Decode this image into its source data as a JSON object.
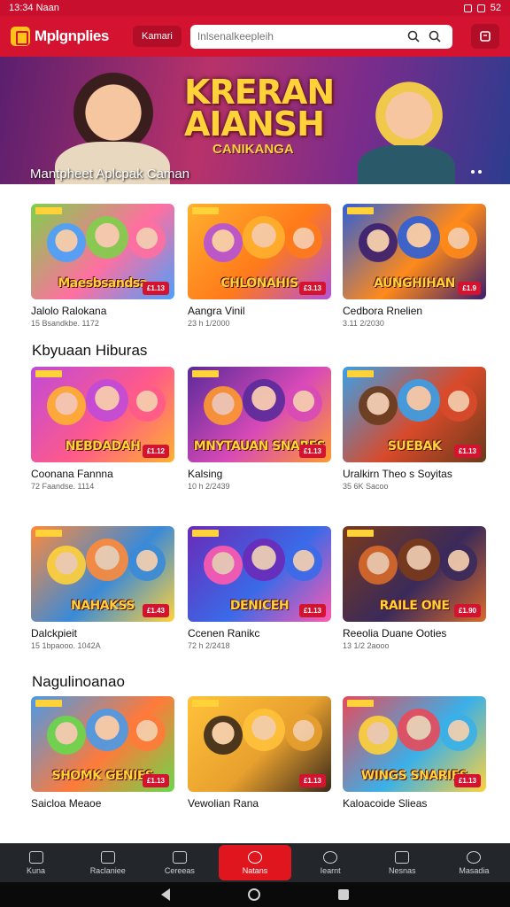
{
  "status": {
    "time": "13:34",
    "carrier": "Naan",
    "battery": "52"
  },
  "header": {
    "app_name": "Mplgnplies",
    "menu_label": "Kamari",
    "search_placeholder": "Inlsenalkeepleih"
  },
  "hero": {
    "title_line1": "KRERAN",
    "title_line2": "AIANSH",
    "subtitle": "CANIKANGA",
    "caption": "Mantpheet Aplcpak Caman"
  },
  "sections": [
    {
      "title": "",
      "cards": [
        {
          "game_name": "Maesbsandsa",
          "title": "Jalolo Ralokana",
          "meta": "15 Bsandkbe. 1172",
          "price": "£1.13",
          "colors": [
            "#7fd04a",
            "#ff6fa0",
            "#4aa0ff"
          ]
        },
        {
          "game_name": "CHLONAHIS",
          "title": "Aangra Vinil",
          "meta": "23 h 1/2000",
          "price": "£3.13",
          "colors": [
            "#ffb02e",
            "#ff7a1a",
            "#b452d8"
          ]
        },
        {
          "game_name": "AUNGHIHAN",
          "title": "Cedbora Rnelien",
          "meta": "3.11 2/2030",
          "price": "£1.9",
          "colors": [
            "#2e5fd8",
            "#ff8a1a",
            "#3a1e6e"
          ]
        }
      ]
    },
    {
      "title": "Kbyuaan Hiburas",
      "cards": [
        {
          "game_name": "NEBDADAH",
          "title": "Coonana Fannna",
          "meta": "72 Faandse. 1114",
          "price": "£1.12",
          "colors": [
            "#c04ad8",
            "#ff5a8a",
            "#ffb12e"
          ]
        },
        {
          "game_name": "MNYTAUAN SNARES",
          "title": "Kalsing",
          "meta": "10 h 2/2439",
          "price": "£1.13",
          "colors": [
            "#5a2a9a",
            "#d84ab8",
            "#ff9a2e"
          ]
        },
        {
          "game_name": "SUEBAK",
          "title": "Uralkirn Theo s Soyitas",
          "meta": "35 6K Sacoo",
          "price": "£1.13",
          "colors": [
            "#3aa0e8",
            "#d84a2a",
            "#6a3a1a"
          ]
        }
      ]
    },
    {
      "title": "",
      "cards": [
        {
          "game_name": "NAHAKSS",
          "title": "Dalckpieit",
          "meta": "15 1bpaooo. 1042A",
          "price": "£1.43",
          "colors": [
            "#ff8a3a",
            "#3a8ad8",
            "#ffd23a"
          ]
        },
        {
          "game_name": "DENICEH",
          "title": "Ccenen Ranikc",
          "meta": "72 h 2/2418",
          "price": "£1.13",
          "colors": [
            "#6a2ab8",
            "#3a6ae8",
            "#ff5ab0"
          ]
        },
        {
          "game_name": "RAILE ONE",
          "title": "Reeolia Duane Ooties",
          "meta": "13 1/2 2aooo",
          "price": "£1.90",
          "colors": [
            "#7a3a1a",
            "#3a2a5a",
            "#d86a2a"
          ]
        }
      ]
    },
    {
      "title": "Nagulinoanao",
      "cards": [
        {
          "game_name": "SHOMK GENIES",
          "title": "Saicloa Meaoe",
          "meta": "",
          "price": "£1.13",
          "colors": [
            "#4a9ae8",
            "#ff7a3a",
            "#6ad84a"
          ]
        },
        {
          "game_name": "",
          "title": "Vewolian Rana",
          "meta": "",
          "price": "£1.13",
          "colors": [
            "#ffc23a",
            "#e8a02e",
            "#3a2a1a"
          ]
        },
        {
          "game_name": "WINGS SNARIES",
          "title": "Kaloacoide Slieas",
          "meta": "",
          "price": "£1.13",
          "colors": [
            "#e84a5a",
            "#3ab0e8",
            "#ffd23a"
          ]
        }
      ]
    }
  ],
  "bottom_nav": [
    {
      "label": "Kuna",
      "icon": "home-icon"
    },
    {
      "label": "Raclaniee",
      "icon": "chart-icon"
    },
    {
      "label": "Cereeas",
      "icon": "gamepad-icon"
    },
    {
      "label": "Natans",
      "icon": "trophy-icon",
      "active": true
    },
    {
      "label": "Iearnt",
      "icon": "globe-icon"
    },
    {
      "label": "Nesnas",
      "icon": "calendar-icon"
    },
    {
      "label": "Masadia",
      "icon": "search-icon"
    }
  ],
  "accent": "#d3132f"
}
